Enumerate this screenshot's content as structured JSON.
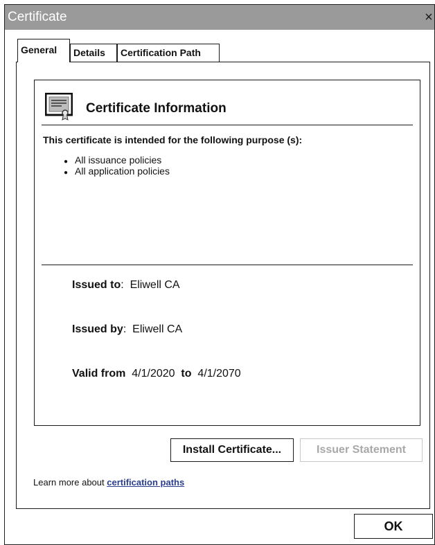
{
  "window": {
    "title": "Certificate",
    "close_glyph": "×"
  },
  "tabs": [
    {
      "label": "General",
      "selected": true
    },
    {
      "label": "Details",
      "selected": false
    },
    {
      "label": "Certification Path",
      "selected": false
    }
  ],
  "info": {
    "icon": "certificate-icon",
    "title": "Certificate Information",
    "purpose_heading": "This certificate is intended for the following purpose (s):",
    "purposes": [
      "All issuance policies",
      "All application policies"
    ],
    "issued_to_label": "Issued to",
    "issued_to_value": "Eliwell CA",
    "issued_by_label": "Issued by",
    "issued_by_value": "Eliwell CA",
    "valid_from_label": "Valid from",
    "valid_from_value": "4/1/2020",
    "valid_to_label": "to",
    "valid_to_value": "4/1/2070"
  },
  "buttons": {
    "install_label": "Install Certificate...",
    "issuer_label": "Issuer Statement",
    "issuer_enabled": false,
    "ok_label": "OK"
  },
  "learn_more": {
    "prefix": "Learn more about ",
    "link_text": "certification paths"
  },
  "colors": {
    "titlebar": "#9a9a9a",
    "link": "#2b3d8f",
    "disabled_text": "#a8a8a8"
  }
}
